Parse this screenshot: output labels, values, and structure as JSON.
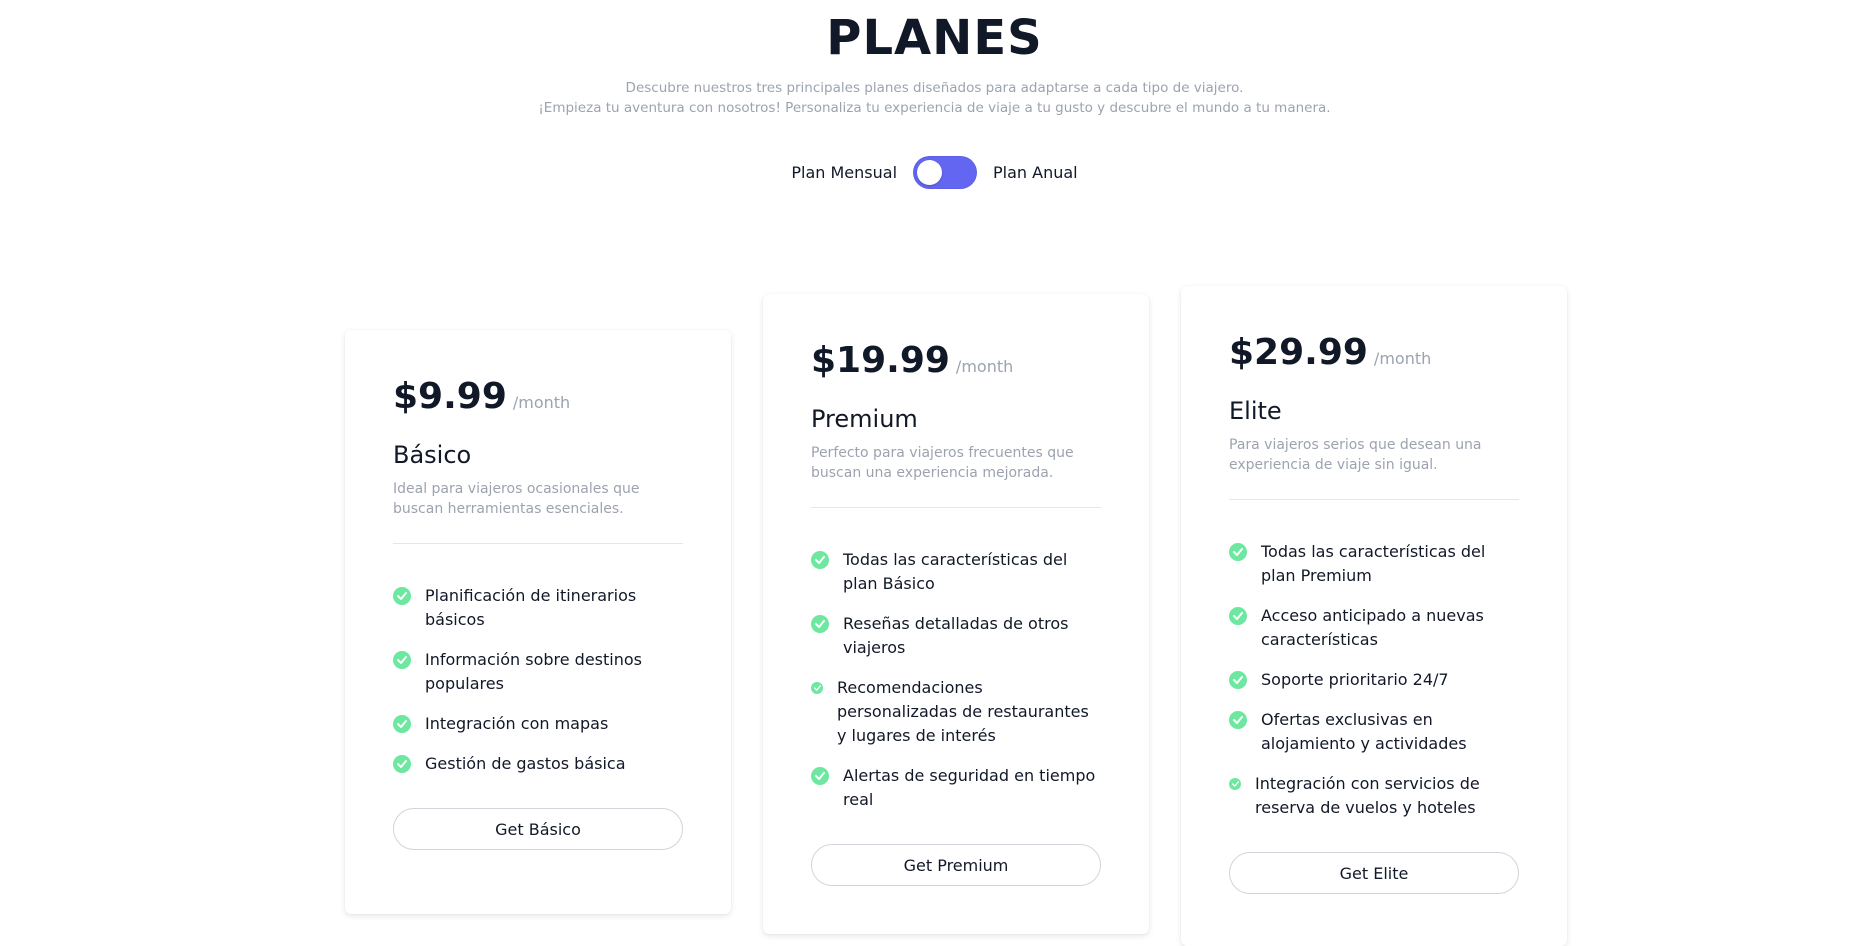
{
  "header": {
    "title": "PLANES",
    "subtitle_line1": "Descubre nuestros tres principales planes diseñados para adaptarse a cada tipo de viajero.",
    "subtitle_line2": "¡Empieza tu aventura con nosotros! Personaliza tu experiencia de viaje a tu gusto y descubre el mundo a tu manera."
  },
  "billing_toggle": {
    "left_label": "Plan Mensual",
    "right_label": "Plan Anual",
    "state": "monthly",
    "accent_color": "#6366f1"
  },
  "plans": [
    {
      "price": "$9.99",
      "period": "/month",
      "name": "Básico",
      "description": "Ideal para viajeros ocasionales que buscan herramientas esenciales.",
      "features": [
        "Planificación de itinerarios básicos",
        "Información sobre destinos populares",
        "Integración con mapas",
        "Gestión de gastos básica"
      ],
      "cta": "Get Básico"
    },
    {
      "price": "$19.99",
      "period": "/month",
      "name": "Premium",
      "description": "Perfecto para viajeros frecuentes que buscan una experiencia mejorada.",
      "features": [
        "Todas las características del plan Básico",
        "Reseñas detalladas de otros viajeros",
        "Recomendaciones personalizadas de restaurantes y lugares de interés",
        "Alertas de seguridad en tiempo real"
      ],
      "cta": "Get Premium"
    },
    {
      "price": "$29.99",
      "period": "/month",
      "name": "Elite",
      "description": "Para viajeros serios que desean una experiencia de viaje sin igual.",
      "features": [
        "Todas las características del plan Premium",
        "Acceso anticipado a nuevas características",
        "Soporte prioritario 24/7",
        "Ofertas exclusivas en alojamiento y actividades",
        "Integración con servicios de reserva de vuelos y hoteles"
      ],
      "cta": "Get Elite"
    }
  ],
  "icons": {
    "feature_bullet": "check-circle-icon",
    "check_color": "#6ee7a0"
  }
}
